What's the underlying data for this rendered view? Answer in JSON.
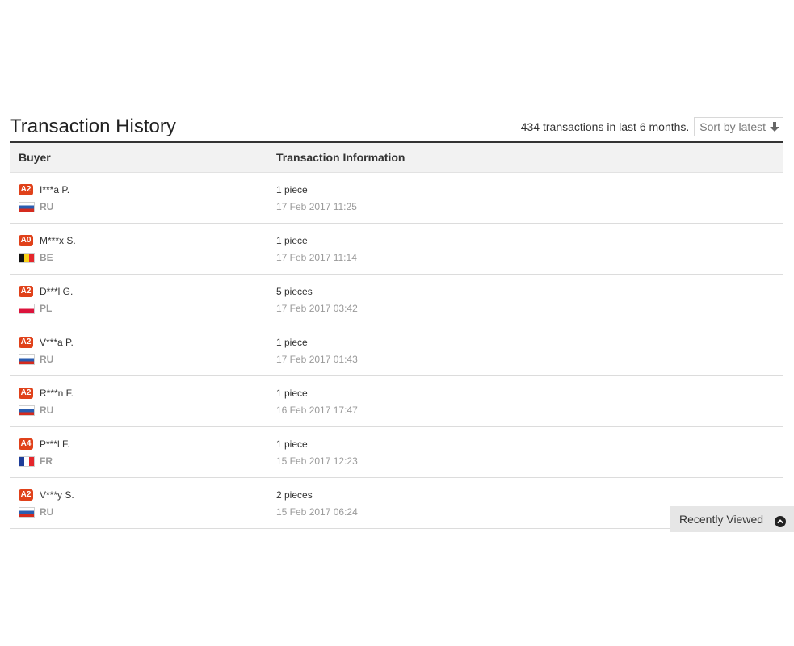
{
  "header": {
    "title": "Transaction History",
    "count_text": "434 transactions in last 6 months.",
    "sort_label": "Sort by latest"
  },
  "table": {
    "columns": [
      "Buyer",
      "Transaction Information"
    ],
    "rows": [
      {
        "level": "A2",
        "name": "I***a P.",
        "country": "RU",
        "flag": "ru",
        "quantity": "1 piece",
        "date": "17 Feb 2017 11:25"
      },
      {
        "level": "A0",
        "name": "M***x S.",
        "country": "BE",
        "flag": "be",
        "quantity": "1 piece",
        "date": "17 Feb 2017 11:14"
      },
      {
        "level": "A2",
        "name": "D***l G.",
        "country": "PL",
        "flag": "pl",
        "quantity": "5 pieces",
        "date": "17 Feb 2017 03:42"
      },
      {
        "level": "A2",
        "name": "V***a P.",
        "country": "RU",
        "flag": "ru",
        "quantity": "1 piece",
        "date": "17 Feb 2017 01:43"
      },
      {
        "level": "A2",
        "name": "R***n F.",
        "country": "RU",
        "flag": "ru",
        "quantity": "1 piece",
        "date": "16 Feb 2017 17:47"
      },
      {
        "level": "A4",
        "name": "P***l F.",
        "country": "FR",
        "flag": "fr",
        "quantity": "1 piece",
        "date": "15 Feb 2017 12:23"
      },
      {
        "level": "A2",
        "name": "V***y S.",
        "country": "RU",
        "flag": "ru",
        "quantity": "2 pieces",
        "date": "15 Feb 2017 06:24"
      }
    ]
  },
  "recently_viewed": {
    "label": "Recently Viewed",
    "icon": "chevron-up-circle-icon"
  },
  "colors": {
    "badge": "#e0411a",
    "header_rule": "#333333",
    "table_header_bg": "#f2f2f2",
    "muted_text": "#9a9a9a"
  }
}
